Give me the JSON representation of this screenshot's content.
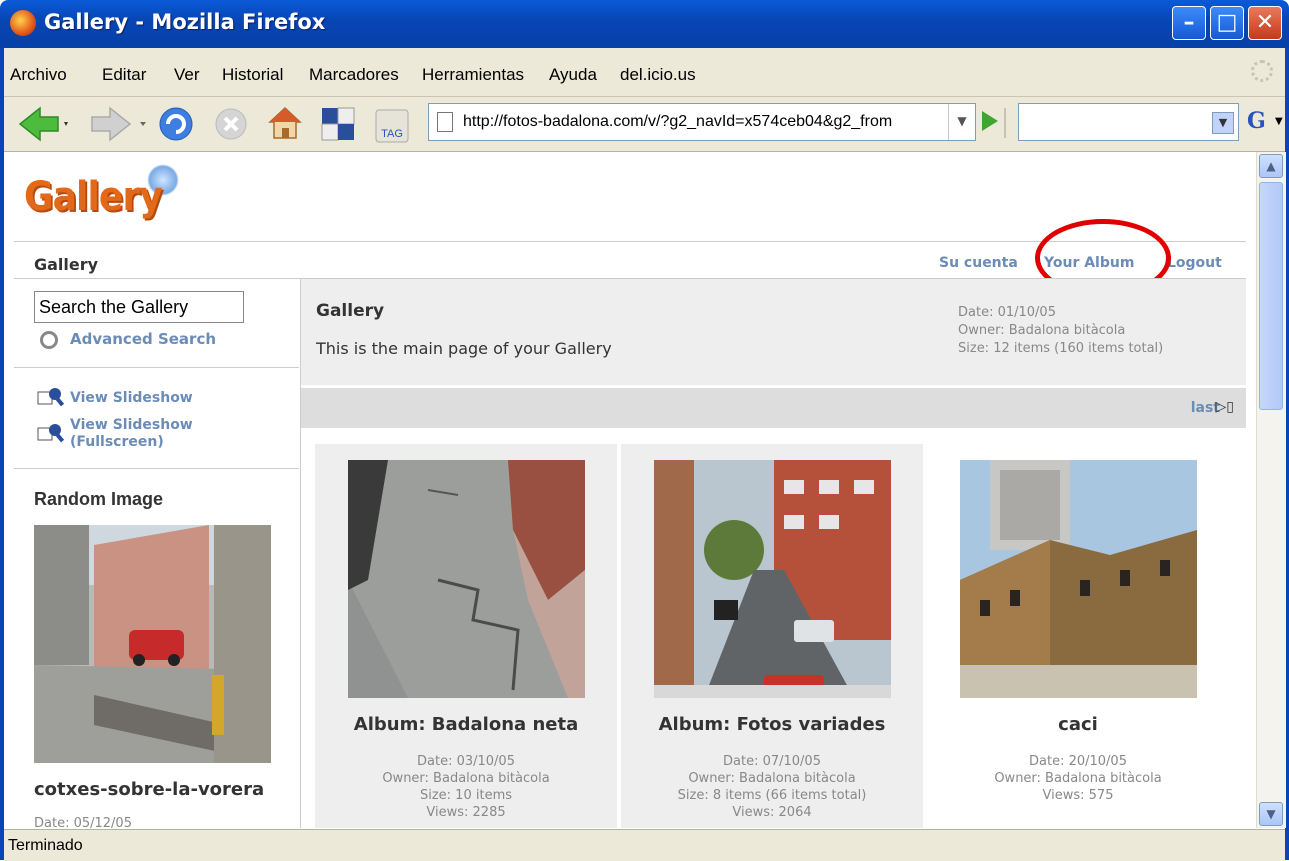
{
  "window": {
    "title": "Gallery - Mozilla Firefox"
  },
  "menubar": {
    "items": [
      "Archivo",
      "Editar",
      "Ver",
      "Historial",
      "Marcadores",
      "Herramientas",
      "Ayuda",
      "del.icio.us"
    ]
  },
  "navbar": {
    "url": "http://fotos-badalona.com/v/?g2_navId=x574ceb04&g2_from",
    "tag_label": "TAG",
    "search_value": ""
  },
  "status": {
    "text": "Terminado"
  },
  "page": {
    "logo": "Gallery",
    "breadcrumb": "Gallery",
    "links": {
      "account": "Su cuenta",
      "your_album": "Your Album",
      "logout": "Logout"
    },
    "sidebar": {
      "search_placeholder": "Search the Gallery",
      "advanced_search": "Advanced Search",
      "slideshow": "View Slideshow",
      "slideshow_full_1": "View Slideshow",
      "slideshow_full_2": "(Fullscreen)",
      "random_heading": "Random Image",
      "random_title": "cotxes-sobre-la-vorera",
      "random_date": "Date: 05/12/05"
    },
    "header": {
      "title": "Gallery",
      "description": "This is the main page of your Gallery",
      "date": "Date: 01/10/05",
      "owner": "Owner: Badalona bitàcola",
      "size": "Size: 12 items (160 items total)"
    },
    "pager": {
      "last": "last"
    },
    "items": [
      {
        "title": "Album: Badalona neta",
        "date": "Date: 03/10/05",
        "owner": "Owner: Badalona bitàcola",
        "size": "Size: 10 items",
        "views": "Views: 2285"
      },
      {
        "title": "Album: Fotos variades",
        "date": "Date: 07/10/05",
        "owner": "Owner: Badalona bitàcola",
        "size": "Size: 8 items (66 items total)",
        "views": "Views: 2064"
      },
      {
        "title": "caci",
        "date": "Date: 20/10/05",
        "owner": "Owner: Badalona bitàcola",
        "views": "Views: 575"
      }
    ]
  }
}
